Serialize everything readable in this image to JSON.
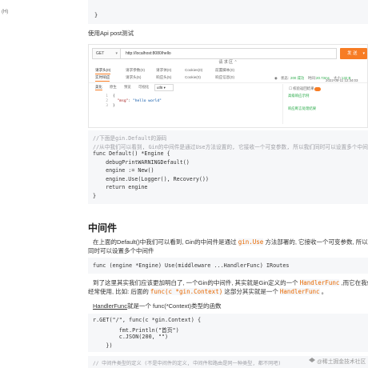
{
  "sidebar_fragment": "(H)",
  "top_code": [
    "}"
  ],
  "intro_text_1": "使用Api post测试",
  "intro_link_word": "Api",
  "postman": {
    "method": "GET",
    "url": "http://localhost:8080/hello",
    "send_label": "发 送",
    "params_toggle": "请 求 区",
    "request_tabs": [
      "Header",
      "Query",
      "Body",
      "Cookies",
      "Auth"
    ],
    "request_tab_labels": [
      "请求头(0)",
      "请求参数(0)",
      "请求体(0)",
      "Cookies(0)",
      "前置脚本(0)"
    ],
    "response_tabs": [
      "实时响应",
      "请求头(5)",
      "响应头(5)",
      "Cookie(0)",
      "响应信息(0)"
    ],
    "response_status_label": "状态:",
    "response_status": "200 成功",
    "response_time_label": "时间:",
    "response_time": "20.73ms",
    "response_size_label": "大小:",
    "response_size": "132 B",
    "date": "2022-05-11 12:34:03",
    "format_tabs": [
      "美化",
      "原生",
      "预览",
      "可视化"
    ],
    "format_select": "utf8",
    "code_lines": [
      {
        "n": "1",
        "text": "{"
      },
      {
        "n": "2",
        "key": "\"msg\"",
        "value": "\"hello world\""
      },
      {
        "n": "3",
        "text": "}"
      }
    ],
    "checkbox_label": "校验返回结果",
    "note_1": "高级响应示例",
    "note_2": "响应断言处理结果"
  },
  "go_code": [
    "//下面是gin.Default的源码",
    "//从中我们可以看到, Gin的中间件是通过Use方法设置的, 它接收一个可变参数, 所以我们同时可以设置多个中间件",
    "func Default() *Engine {",
    "    debugPrintWARNINGDefault()",
    "    engine := New()",
    "    engine.Use(Logger(), Recovery())",
    "    return engine",
    "}"
  ],
  "heading": "中间件",
  "para_1": {
    "a": "在上面的Default()中我们可以看到, Gin的中间件是通过 ",
    "code": "gin.Use",
    "b": " 方法部署的, 它接收一个可变参数, 所以我们"
  },
  "para_1b": "同时可以设置多个中间件",
  "sig_code": "func (engine *Engine) Use(middleware ...HandlerFunc) IRoutes",
  "para_2": {
    "a": "到了这里其实我们应该更加明白了, 一个Gin的中间件, 其实就是Gin定义的一个 ",
    "code1": "HandlerFunc",
    "b": " ,而它在我们Gin",
    "line2a": "经常使用, 比如:     后面的 ",
    "code2": "func(c *gin.Context)",
    "line2b": " 这部分其实就是一个 ",
    "code3": "HandlerFunc",
    "line2c": " 。"
  },
  "para_3": {
    "link": "HandlerFunc",
    "rest": "就是一个 func(*Context)类型的函数"
  },
  "handler_code": [
    "r.GET(\"/\", func(c *gin.Context) {",
    "        fmt.Println(\"首页\")",
    "        c.JSON(200, \"\")",
    "    })"
  ],
  "bottom_code": "// 中间件类型的定义 (不是中间件的定义, 中间件和路由是同一种类型, 都不同吧)",
  "watermark": "@稀土掘金技术社区"
}
